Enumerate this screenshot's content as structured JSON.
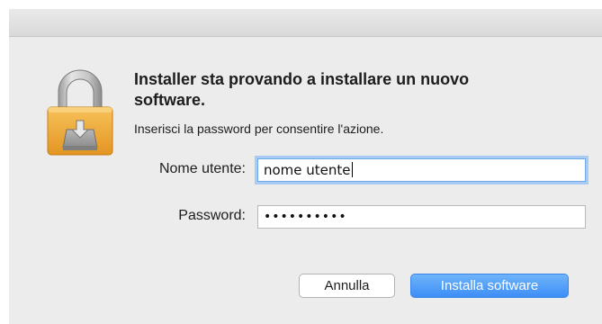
{
  "dialog": {
    "heading": "Installer sta provando a installare un nuovo software.",
    "subtext": "Inserisci la password per consentire l'azione.",
    "icon": "lock-installer-icon"
  },
  "form": {
    "username_label": "Nome utente:",
    "username_value": "nome utente",
    "password_label": "Password:",
    "password_mask": "••••••••••"
  },
  "buttons": {
    "cancel_label": "Annulla",
    "install_label": "Installa software"
  },
  "colors": {
    "accent": "#3d8ef6",
    "focus_ring": "#a8cbf3",
    "dialog_bg": "#ececec"
  }
}
